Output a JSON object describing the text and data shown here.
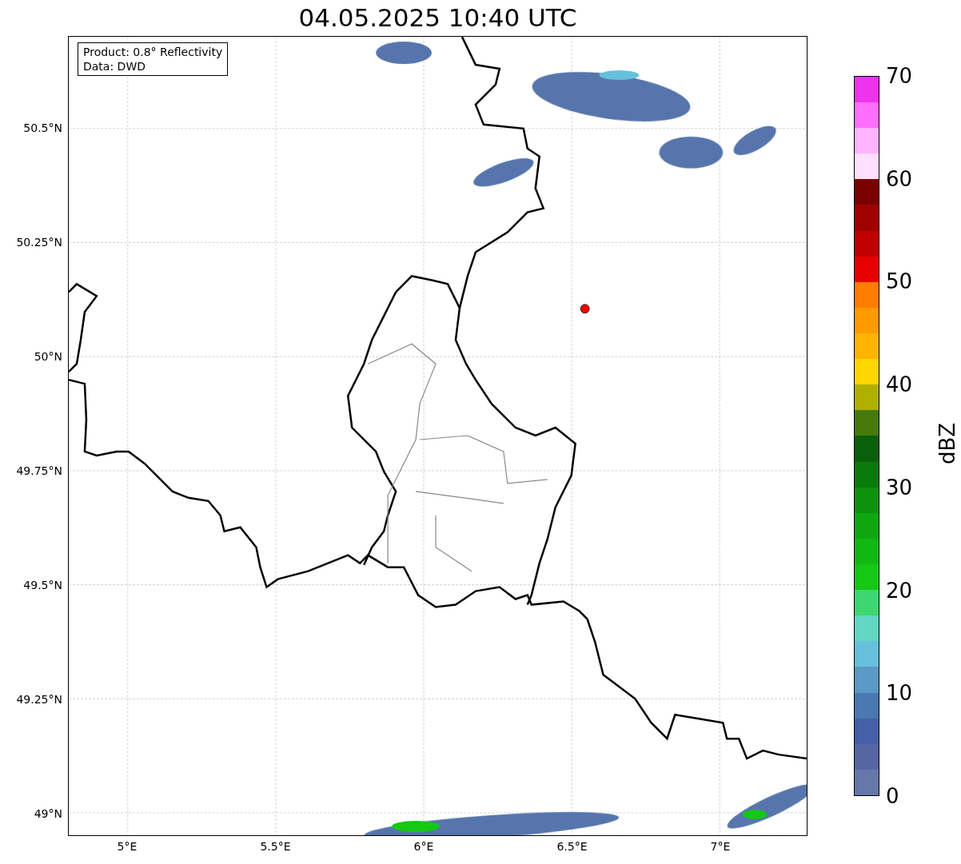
{
  "title": "04.05.2025 10:40 UTC",
  "map": {
    "info_lines": [
      "Product: 0.8° Reflectivity",
      "Data: DWD"
    ],
    "y_ticks": [
      "50.5°N",
      "50.25°N",
      "50°N",
      "49.75°N",
      "49.5°N",
      "49.25°N",
      "49°N"
    ],
    "x_ticks": [
      "5°E",
      "5.5°E",
      "6°E",
      "6.5°E",
      "7°E"
    ]
  },
  "colorbar": {
    "label": "dBZ",
    "ticks": [
      "70",
      "60",
      "50",
      "40",
      "30",
      "20",
      "10",
      "0"
    ],
    "bands": [
      {
        "color": "#6677aa"
      },
      {
        "color": "#5566a2"
      },
      {
        "color": "#4460a6"
      },
      {
        "color": "#4a78b0"
      },
      {
        "color": "#5a9ac4"
      },
      {
        "color": "#66c0dc"
      },
      {
        "color": "#62d8c4"
      },
      {
        "color": "#3dd670"
      },
      {
        "color": "#14c814"
      },
      {
        "color": "#10b810"
      },
      {
        "color": "#0ea80e"
      },
      {
        "color": "#0c920c"
      },
      {
        "color": "#0a7a0a"
      },
      {
        "color": "#0a5f0a"
      },
      {
        "color": "#467a0a"
      },
      {
        "color": "#afb000"
      },
      {
        "color": "#ffd700"
      },
      {
        "color": "#ffb400"
      },
      {
        "color": "#ff9a00"
      },
      {
        "color": "#ff7d00"
      },
      {
        "color": "#e60000"
      },
      {
        "color": "#c00000"
      },
      {
        "color": "#a00000"
      },
      {
        "color": "#7a0000"
      },
      {
        "color": "#ffe0ff"
      },
      {
        "color": "#ffb4ff"
      },
      {
        "color": "#ff6eff"
      },
      {
        "color": "#ee33ee"
      }
    ]
  }
}
